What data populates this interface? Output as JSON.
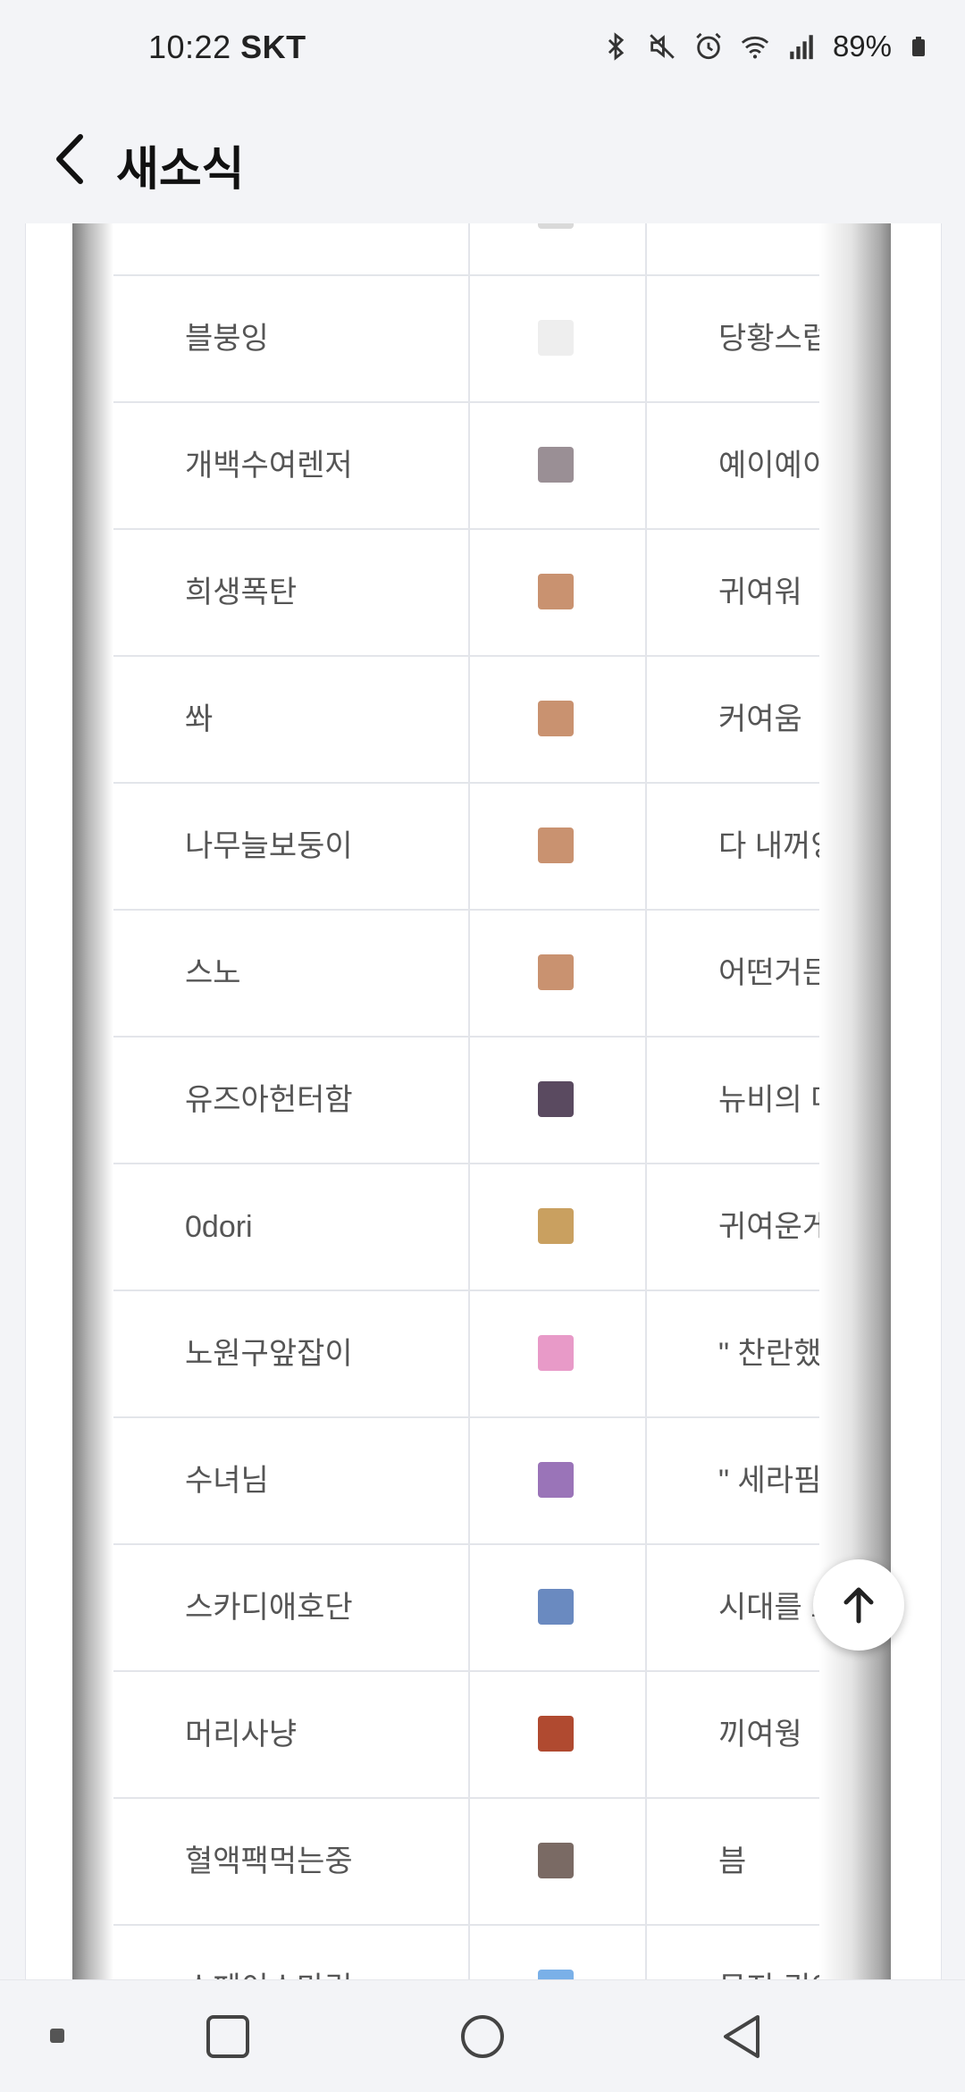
{
  "status_bar": {
    "time": "10:22",
    "carrier": "SKT",
    "battery": "89%",
    "icons": [
      "bluetooth-icon",
      "mute-icon",
      "alarm-icon",
      "wifi-icon",
      "signal-icon",
      "battery-icon"
    ]
  },
  "header": {
    "back_icon": "chevron-left-icon",
    "title": "새소식"
  },
  "table": {
    "rows": [
      {
        "name": "",
        "text": "",
        "icon_color": "#d9d9d9"
      },
      {
        "name": "블붕잉",
        "text": "당황스럽당",
        "icon_color": "#eeeeee"
      },
      {
        "name": "개백수여렌저",
        "text": "예이예이~",
        "icon_color": "#9a8f95"
      },
      {
        "name": "희생폭탄",
        "text": "귀여워",
        "icon_color": "#c99270"
      },
      {
        "name": "쏴",
        "text": "커여움",
        "icon_color": "#c99270"
      },
      {
        "name": "나무늘보둥이",
        "text": "다 내꺼양!!!을 맡",
        "icon_color": "#c99270"
      },
      {
        "name": "스노",
        "text": "어떤거든 애정하",
        "icon_color": "#c99270"
      },
      {
        "name": "유즈아헌터함",
        "text": "뉴비의 마음을 l",
        "icon_color": "#5a4a60"
      },
      {
        "name": "0dori",
        "text": "귀여운게진리",
        "icon_color": "#c9a060"
      },
      {
        "name": "노원구앞잡이",
        "text": "\" 찬란했던 그 사",
        "icon_color": "#e89ac8"
      },
      {
        "name": "수녀님",
        "text": "\" 세라핌단을 다",
        "icon_color": "#9a74b8"
      },
      {
        "name": "스카디애호단",
        "text": "시대를 조",
        "icon_color": "#6a8ac0"
      },
      {
        "name": "머리사냥",
        "text": "끼여웡",
        "icon_color": "#b04a30"
      },
      {
        "name": "혈액팩먹는중",
        "text": "븜",
        "icon_color": "#7a6a64"
      },
      {
        "name": "스페이스마린",
        "text": "무지 귀여",
        "icon_color": "#7ab0e8"
      }
    ]
  },
  "scroll_top": {
    "icon": "arrow-up-icon"
  },
  "nav_bar": {
    "items": [
      "recent-apps-dot-icon",
      "square-icon",
      "circle-home-icon",
      "triangle-back-icon"
    ]
  }
}
